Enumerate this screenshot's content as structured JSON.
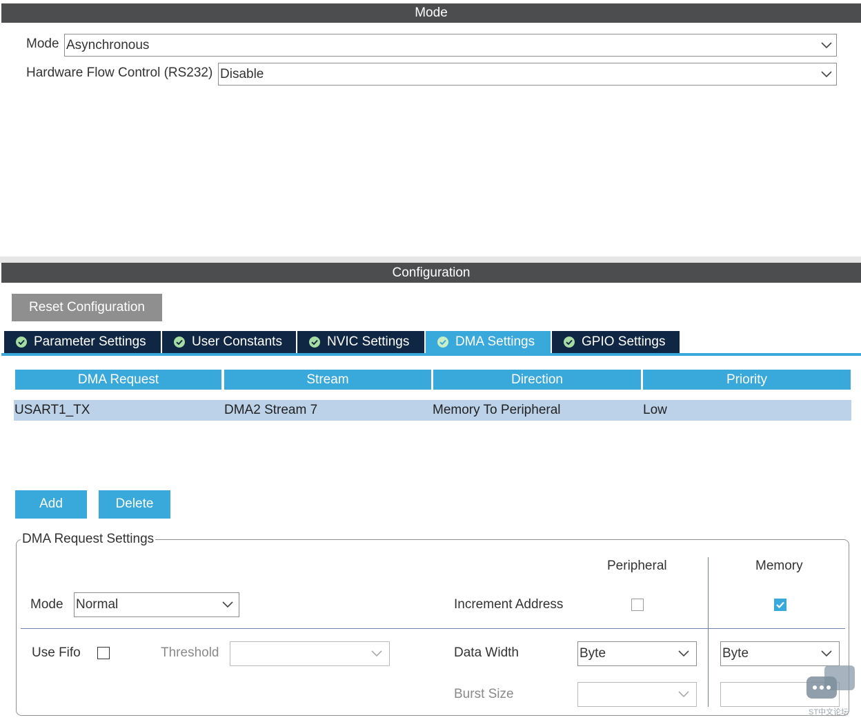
{
  "mode_panel": {
    "header": "Mode",
    "mode_label": "Mode",
    "mode_value": "Asynchronous",
    "flow_label": "Hardware Flow Control (RS232)",
    "flow_value": "Disable"
  },
  "config_panel": {
    "header": "Configuration",
    "reset_label": "Reset Configuration",
    "tabs": [
      {
        "label": "Parameter Settings",
        "active": false,
        "icon": "check-circle-icon"
      },
      {
        "label": "User Constants",
        "active": false,
        "icon": "check-circle-icon"
      },
      {
        "label": "NVIC Settings",
        "active": false,
        "icon": "check-circle-icon"
      },
      {
        "label": "DMA Settings",
        "active": true,
        "icon": "check-circle-icon"
      },
      {
        "label": "GPIO Settings",
        "active": false,
        "icon": "check-circle-icon"
      }
    ],
    "table": {
      "columns": [
        "DMA Request",
        "Stream",
        "Direction",
        "Priority"
      ],
      "rows": [
        [
          "USART1_TX",
          "DMA2 Stream 7",
          "Memory To Peripheral",
          "Low"
        ]
      ]
    },
    "add_label": "Add",
    "delete_label": "Delete"
  },
  "dma_request_settings": {
    "legend": "DMA Request Settings",
    "peripheral_header": "Peripheral",
    "memory_header": "Memory",
    "mode_label": "Mode",
    "mode_value": "Normal",
    "increment_label": "Increment Address",
    "increment_peripheral": false,
    "increment_memory": true,
    "use_fifo_label": "Use Fifo",
    "use_fifo": false,
    "threshold_label": "Threshold",
    "threshold_value": "",
    "data_width_label": "Data Width",
    "data_width_peripheral": "Byte",
    "data_width_memory": "Byte",
    "burst_size_label": "Burst Size",
    "burst_peripheral": "",
    "burst_memory": ""
  },
  "watermark": "ST中文论坛",
  "colors": {
    "header_bar": "#4c4d4e",
    "accent": "#39a9dc",
    "tab_dark": "#0f2744",
    "row_selected": "#bcd2e8"
  }
}
